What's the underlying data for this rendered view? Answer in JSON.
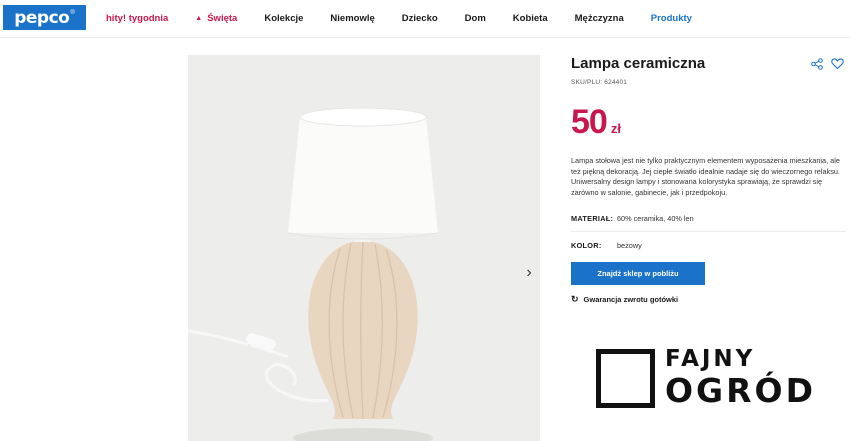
{
  "header": {
    "logo_text": "pepco",
    "logo_mark": "®",
    "logo_color": "#1a73c9",
    "nav": [
      {
        "label": "hity! tygodnia",
        "accent": "#c8174d"
      },
      {
        "label": "Święta",
        "icon": "bell-icon",
        "accent": "#c8174d"
      },
      {
        "label": "Kolekcje"
      },
      {
        "label": "Niemowlę"
      },
      {
        "label": "Dziecko"
      },
      {
        "label": "Dom"
      },
      {
        "label": "Kobieta"
      },
      {
        "label": "Mężczyzna"
      },
      {
        "label": "Produkty",
        "accent": "#1a73c9"
      }
    ]
  },
  "gallery": {
    "image_description": "white ceramic table lamp with fabric shade and ribbed beige base",
    "next_icon": "chevron-right-icon"
  },
  "product": {
    "title": "Lampa ceramiczna",
    "sku": "SKU/PLU: 624401",
    "price_amount": "50",
    "price_currency": "zł",
    "price_color": "#c8174d",
    "description": "Lampa stołowa jest nie tylko praktycznym elementem wyposażenia mieszkania, ale też piękną dekoracją. Jej ciepłe światło idealnie nadaje się do wieczornego relaksu. Uniwersalny design lampy i stonowana kolorystyka sprawiają, że sprawdzi się zarówno w salonie, gabinecie, jak i przedpokoju.",
    "attributes": [
      {
        "label": "MATERIAŁ:",
        "value": "60% ceramika, 40% len"
      },
      {
        "label": "KOLOR:",
        "value": "beżowy"
      }
    ],
    "find_store_label": "Znajdź sklep w pobliżu",
    "find_store_color": "#1a73c9",
    "guarantee_label": "Gwarancja zwrotu gotówki",
    "share_icon": "share-icon",
    "wishlist_icon": "heart-icon"
  },
  "watermark": {
    "line1": "FAJNY",
    "line2": "OGRÓD"
  }
}
